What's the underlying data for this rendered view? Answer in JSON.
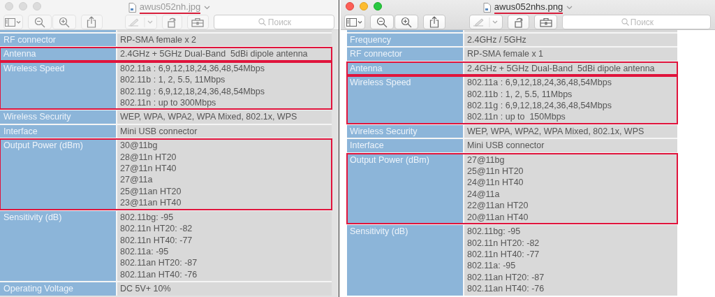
{
  "windows": [
    {
      "title": "awus052nh.jpg",
      "active": false,
      "search_placeholder": "Поиск",
      "rows": [
        {
          "label": "RF connector",
          "values": [
            "RP-SMA female x 2"
          ],
          "highlighted": false
        },
        {
          "label": "Antenna",
          "values": [
            "2.4GHz + 5GHz Dual-Band  5dBi dipole antenna"
          ],
          "highlighted": true
        },
        {
          "label": "Wireless Speed",
          "values": [
            "802.11a : 6,9,12,18,24,36,48,54Mbps",
            "802.11b : 1, 2, 5.5, 11Mbps",
            "802.11g : 6,9,12,18,24,36,48,54Mbps",
            "802.11n : up to 300Mbps"
          ],
          "highlighted": true
        },
        {
          "label": "Wireless Security",
          "values": [
            "WEP, WPA, WPA2, WPA Mixed, 802.1x, WPS"
          ],
          "highlighted": false
        },
        {
          "label": "Interface",
          "values": [
            "Mini USB connector"
          ],
          "highlighted": false
        },
        {
          "label": "Output Power (dBm)",
          "values": [
            "30@11bg",
            "28@11n HT20",
            "27@11n HT40",
            "27@11a",
            "25@11an HT20",
            "23@11an HT40"
          ],
          "highlighted": true
        },
        {
          "label": "Sensitivity (dB)",
          "values": [
            "802.11bg: -95",
            "802.11n HT20: -82",
            "802.11n HT40: -77",
            "802.11a: -95",
            "802.11an HT20: -87",
            "802.11an HT40: -76"
          ],
          "highlighted": false
        },
        {
          "label": "Operating Voltage",
          "values": [
            "DC 5V+ 10%"
          ],
          "highlighted": false
        }
      ]
    },
    {
      "title": "awus052nhs.png",
      "active": true,
      "search_placeholder": "Поиск",
      "rows": [
        {
          "label": "Frequency",
          "values": [
            "2.4GHz / 5GHz"
          ],
          "highlighted": false
        },
        {
          "label": "RF connector",
          "values": [
            "RP-SMA female x 1"
          ],
          "highlighted": false
        },
        {
          "label": "Antenna",
          "values": [
            "2.4GHz + 5GHz Dual-Band  5dBi dipole antenna"
          ],
          "highlighted": true
        },
        {
          "label": "Wireless Speed",
          "values": [
            "802.11a : 6,9,12,18,24,36,48,54Mbps",
            "802.11b : 1, 2, 5.5, 11Mbps",
            "802.11g : 6,9,12,18,24,36,48,54Mbps",
            "802.11n : up to  150Mbps"
          ],
          "highlighted": true
        },
        {
          "label": "Wireless Security",
          "values": [
            "WEP, WPA, WPA2, WPA Mixed, 802.1x, WPS"
          ],
          "highlighted": false
        },
        {
          "label": "Interface",
          "values": [
            "Mini USB connector"
          ],
          "highlighted": false
        },
        {
          "label": "Output Power (dBm)",
          "values": [
            "27@11bg",
            "25@11n HT20",
            "24@11n HT40",
            "24@11a",
            "22@11an HT20",
            "20@11an HT40"
          ],
          "highlighted": true
        },
        {
          "label": "Sensitivity (dB)",
          "values": [
            "802.11bg: -95",
            "802.11n HT20: -82",
            "802.11n HT40: -77",
            "802.11a: -95",
            "802.11an HT20: -87",
            "802.11an HT40: -76"
          ],
          "highlighted": false
        }
      ]
    }
  ]
}
